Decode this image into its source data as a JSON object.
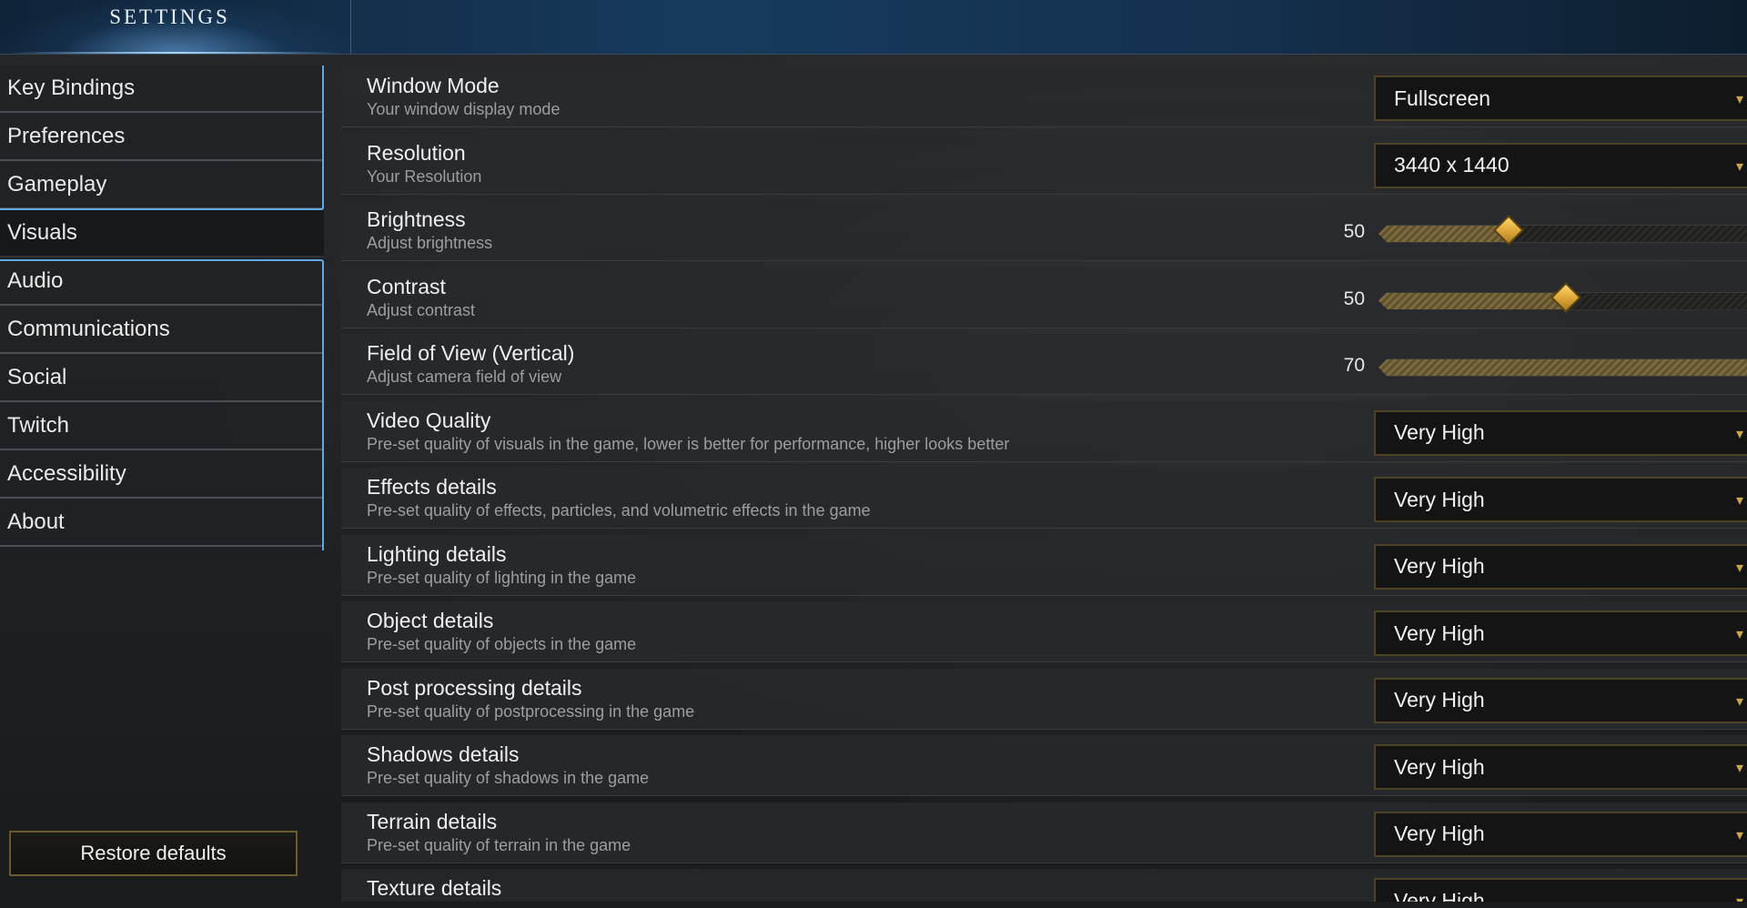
{
  "header": {
    "title": "SETTINGS"
  },
  "sidebar": {
    "items": [
      {
        "label": "Key Bindings",
        "name": "key-bindings"
      },
      {
        "label": "Preferences",
        "name": "preferences"
      },
      {
        "label": "Gameplay",
        "name": "gameplay"
      },
      {
        "label": "Visuals",
        "name": "visuals",
        "active": true
      },
      {
        "label": "Audio",
        "name": "audio"
      },
      {
        "label": "Communications",
        "name": "communications"
      },
      {
        "label": "Social",
        "name": "social"
      },
      {
        "label": "Twitch",
        "name": "twitch"
      },
      {
        "label": "Accessibility",
        "name": "accessibility"
      },
      {
        "label": "About",
        "name": "about"
      }
    ],
    "restore_label": "Restore defaults"
  },
  "settings": [
    {
      "name": "window-mode",
      "label": "Window Mode",
      "desc": "Your window display mode",
      "control": "dropdown",
      "value": "Fullscreen"
    },
    {
      "name": "resolution",
      "label": "Resolution",
      "desc": "Your Resolution",
      "control": "dropdown",
      "value": "3440 x 1440"
    },
    {
      "name": "brightness",
      "label": "Brightness",
      "desc": "Adjust brightness",
      "control": "slider",
      "value": "50",
      "fill_fraction": 0.34
    },
    {
      "name": "contrast",
      "label": "Contrast",
      "desc": "Adjust contrast",
      "control": "slider",
      "value": "50",
      "fill_fraction": 0.49
    },
    {
      "name": "field-of-view",
      "label": "Field of View (Vertical)",
      "desc": "Adjust camera field of view",
      "control": "slider",
      "value": "70",
      "fill_fraction": 1.0
    },
    {
      "name": "video-quality",
      "label": "Video Quality",
      "desc": "Pre-set quality of visuals in the game, lower is better for performance, higher looks better",
      "control": "dropdown",
      "value": "Very High"
    },
    {
      "name": "effects-details",
      "label": "Effects details",
      "desc": "Pre-set quality of effects, particles, and volumetric effects in the game",
      "control": "dropdown",
      "value": "Very High"
    },
    {
      "name": "lighting-details",
      "label": "Lighting details",
      "desc": "Pre-set quality of lighting in the game",
      "control": "dropdown",
      "value": "Very High"
    },
    {
      "name": "object-details",
      "label": "Object details",
      "desc": "Pre-set quality of objects in the game",
      "control": "dropdown",
      "value": "Very High"
    },
    {
      "name": "post-processing-details",
      "label": "Post processing details",
      "desc": "Pre-set quality of postprocessing in the game",
      "control": "dropdown",
      "value": "Very High"
    },
    {
      "name": "shadows-details",
      "label": "Shadows details",
      "desc": "Pre-set quality of shadows in the game",
      "control": "dropdown",
      "value": "Very High"
    },
    {
      "name": "terrain-details",
      "label": "Terrain details",
      "desc": "Pre-set quality of terrain in the game",
      "control": "dropdown",
      "value": "Very High"
    },
    {
      "name": "texture-details",
      "label": "Texture details",
      "desc": "",
      "control": "dropdown",
      "value": "Very High"
    }
  ],
  "icons": {
    "dropdown_chevron": "▾"
  },
  "colors": {
    "accent_blue": "#5fa8e6",
    "accent_gold": "#c9a64a",
    "dropdown_border": "#4d4223"
  }
}
